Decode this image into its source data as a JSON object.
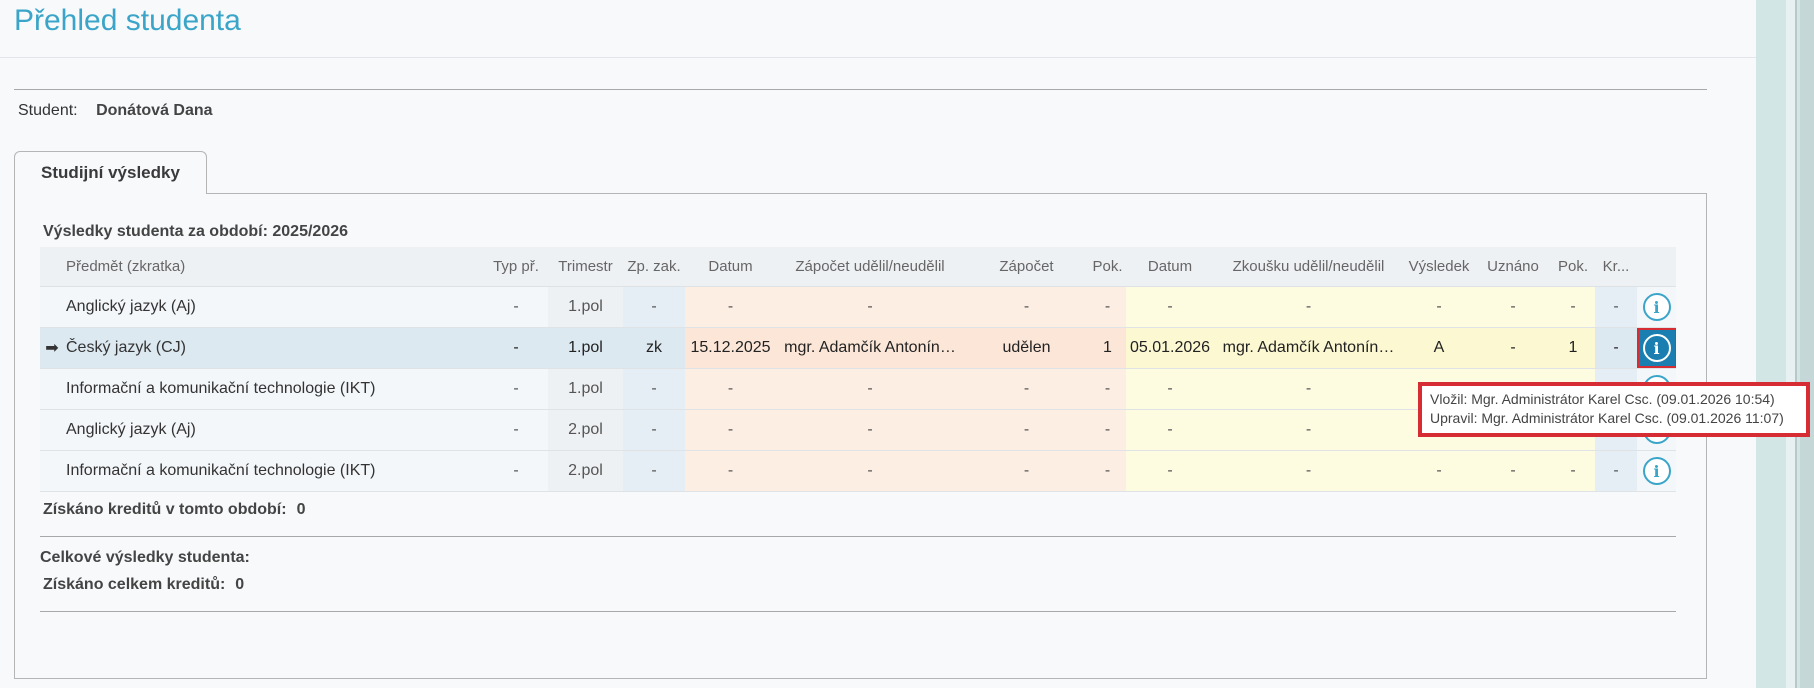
{
  "page": {
    "title": "Přehled studenta"
  },
  "student": {
    "label": "Student:",
    "name": "Donátová Dana"
  },
  "tabs": [
    {
      "label": "Studijní výsledky"
    }
  ],
  "period": {
    "title": "Výsledky studenta za období: 2025/2026"
  },
  "table": {
    "headers": [
      "Předmět (zkratka)",
      "Typ př.",
      "Trimestr",
      "Zp. zak.",
      "Datum",
      "Zápočet udělil/neudělil",
      "Zápočet",
      "Pok.",
      "Datum",
      "Zkoušku udělil/neudělil",
      "Výsledek",
      "Uznáno",
      "Pok.",
      "Kr..."
    ],
    "rows": [
      {
        "selected": false,
        "cells": [
          "Anglický jazyk (Aj)",
          "-",
          "1.pol",
          "-",
          "-",
          "-",
          "-",
          "-",
          "-",
          "-",
          "-",
          "-",
          "-",
          "-"
        ]
      },
      {
        "selected": true,
        "cells": [
          "Český jazyk (CJ)",
          "-",
          "1.pol",
          "zk",
          "15.12.2025",
          "mgr. Adamčík Antonín…",
          "udělen",
          "1",
          "05.01.2026",
          "mgr. Adamčík Antonín…",
          "A",
          "-",
          "1",
          "-"
        ]
      },
      {
        "selected": false,
        "cells": [
          "Informační a komunikační technologie (IKT)",
          "-",
          "1.pol",
          "-",
          "-",
          "-",
          "-",
          "-",
          "-",
          "-",
          "-",
          "-",
          "-",
          "-"
        ]
      },
      {
        "selected": false,
        "cells": [
          "Anglický jazyk (Aj)",
          "-",
          "2.pol",
          "-",
          "-",
          "-",
          "-",
          "-",
          "-",
          "-",
          "-",
          "-",
          "-",
          "-"
        ]
      },
      {
        "selected": false,
        "cells": [
          "Informační a komunikační technologie (IKT)",
          "-",
          "2.pol",
          "-",
          "-",
          "-",
          "-",
          "-",
          "-",
          "-",
          "-",
          "-",
          "-",
          "-"
        ]
      }
    ],
    "row_icon": "info-icon",
    "selected_marker_icon": "arrow-right-icon"
  },
  "period_credits": {
    "label": "Získáno kreditů v tomto období:",
    "value": "0"
  },
  "totals": {
    "title": "Celkové výsledky studenta:",
    "credits_label": "Získáno celkem kreditů:",
    "credits_value": "0"
  },
  "tooltip": {
    "line1": "Vložil: Mgr. Administrátor  Karel Csc. (09.01.2026 10:54)",
    "line2": "Upravil: Mgr. Administrátor  Karel Csc. (09.01.2026 11:07)"
  },
  "colors": {
    "accent": "#3aa5c8",
    "highlight": "#d62d35",
    "zapocet_bg": "#fdeee4",
    "zkouska_bg": "#fdfbe0"
  }
}
